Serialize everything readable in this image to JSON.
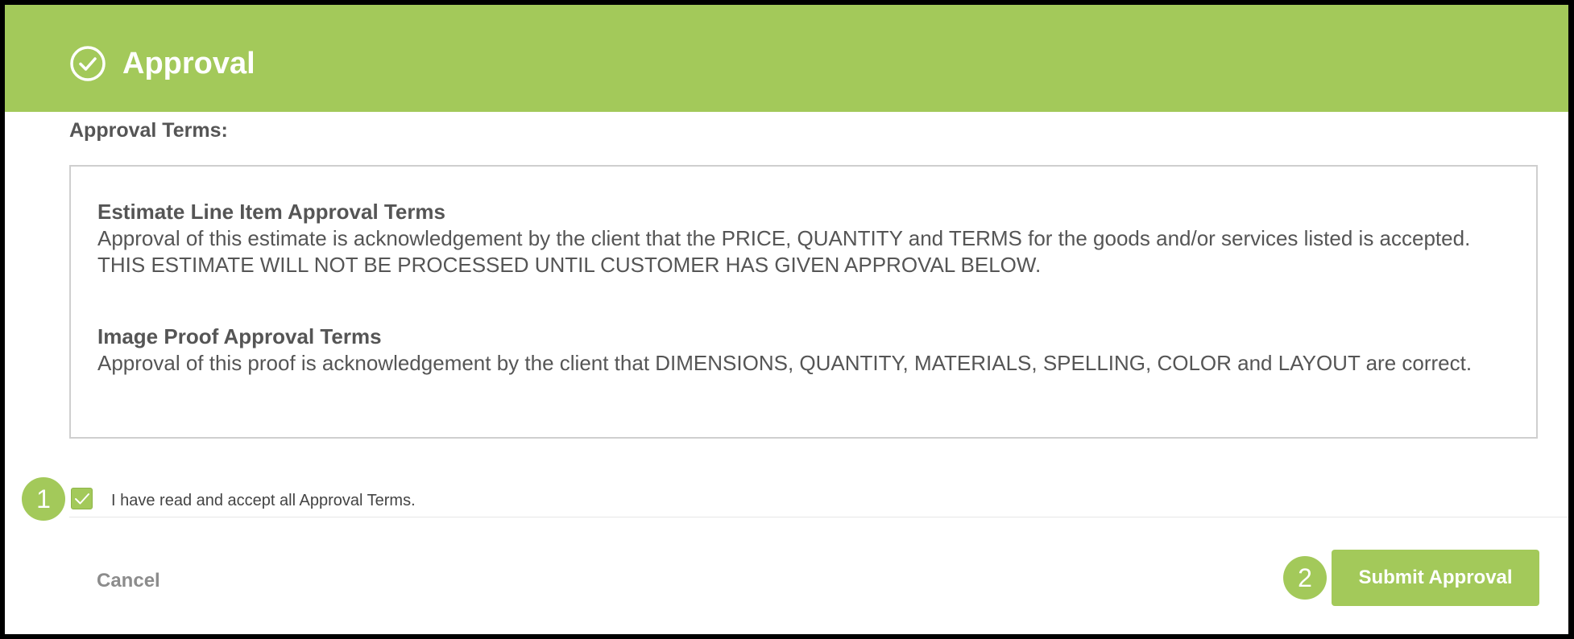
{
  "header": {
    "title": "Approval",
    "icon": "check-circle-icon",
    "background_color": "#a3c95a"
  },
  "approval_terms": {
    "heading": "Approval Terms:",
    "estimate_terms": {
      "title": "Estimate Line Item Approval Terms",
      "body": "Approval of this estimate is acknowledgement by the client that the PRICE, QUANTITY and TERMS for the goods and/or services listed is accepted. THIS ESTIMATE WILL NOT BE PROCESSED UNTIL CUSTOMER HAS GIVEN APPROVAL BELOW."
    },
    "proof_terms": {
      "title": "Image Proof Approval Terms",
      "body": "Approval of this proof is acknowledgement by the client that DIMENSIONS, QUANTITY, MATERIALS, SPELLING, COLOR and LAYOUT are correct."
    }
  },
  "acceptance": {
    "checked": true,
    "label": "I have read and accept all Approval Terms."
  },
  "step_badges": {
    "step1": "1",
    "step2": "2"
  },
  "actions": {
    "cancel_label": "Cancel",
    "submit_label": "Submit Approval"
  },
  "colors": {
    "accent": "#a3c95a",
    "text": "#555555",
    "muted": "#8c8c8c"
  }
}
